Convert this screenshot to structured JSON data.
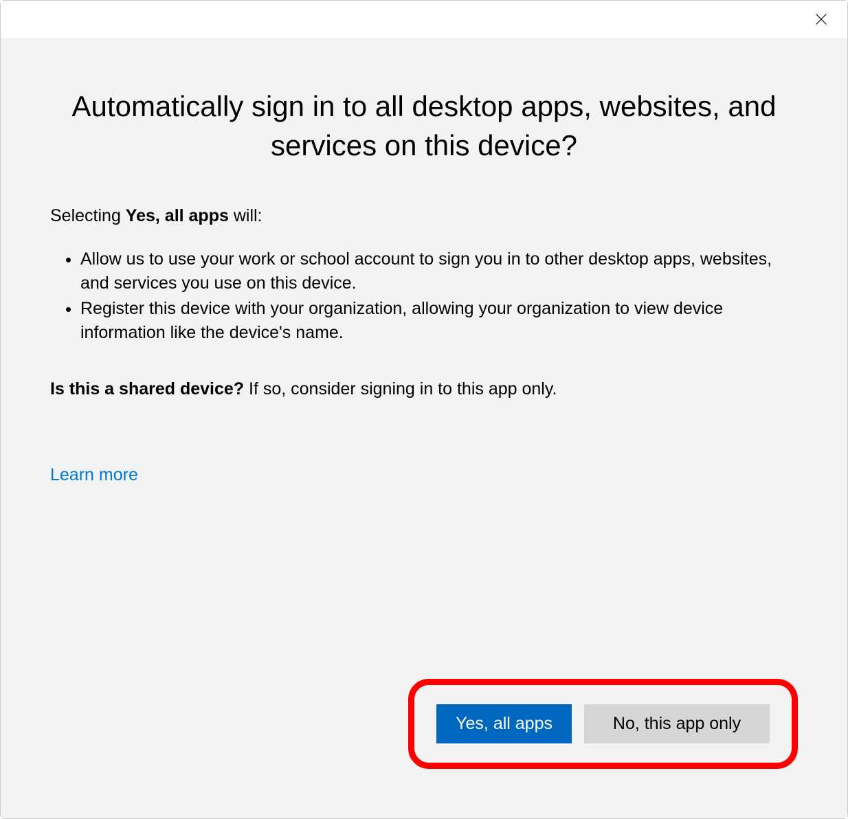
{
  "dialog": {
    "heading": "Automatically sign in to all desktop apps, websites, and services on this device?",
    "intro_prefix": "Selecting ",
    "intro_bold": "Yes, all apps",
    "intro_suffix": " will:",
    "bullets": [
      "Allow us to use your work or school account to sign you in to other desktop apps, websites, and services you use on this device.",
      "Register this device with your organization, allowing your organization to view device information like the device's name."
    ],
    "shared_bold": "Is this a shared device?",
    "shared_rest": " If so, consider signing in to this app only.",
    "learn_more": "Learn more",
    "buttons": {
      "primary": "Yes, all apps",
      "secondary": "No, this app only"
    }
  }
}
